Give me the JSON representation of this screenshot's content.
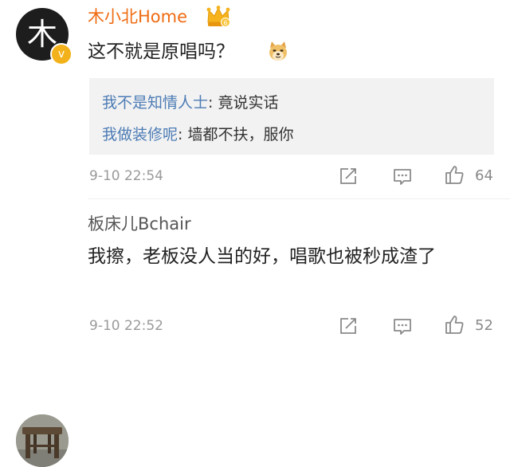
{
  "comments": [
    {
      "username": "木小北Home",
      "avatar_glyph": "木",
      "badge_icon": "crown-icon",
      "verified_icon": "verified-v-icon",
      "verified_mark": "v",
      "text": "这不就是原唱吗？",
      "emoji_icon": "doge-emoji-icon",
      "replies": [
        {
          "name": "我不是知情人士",
          "text": ": 竟说实话"
        },
        {
          "name": "我做装修呢",
          "text": ": 墙都不扶，服你"
        }
      ],
      "time": "9-10 22:54",
      "likes": "64"
    },
    {
      "username": "板床儿Bchair",
      "avatar_icon": "wooden-stool-avatar",
      "text": "我擦，老板没人当的好，唱歌也被秒成渣了",
      "time": "9-10 22:52",
      "likes": "52"
    }
  ],
  "colors": {
    "vip_name": "#ef6b12",
    "reply_name": "#4d7cb5",
    "reply_bg": "#f2f2f2",
    "meta": "#9a9a9a"
  }
}
